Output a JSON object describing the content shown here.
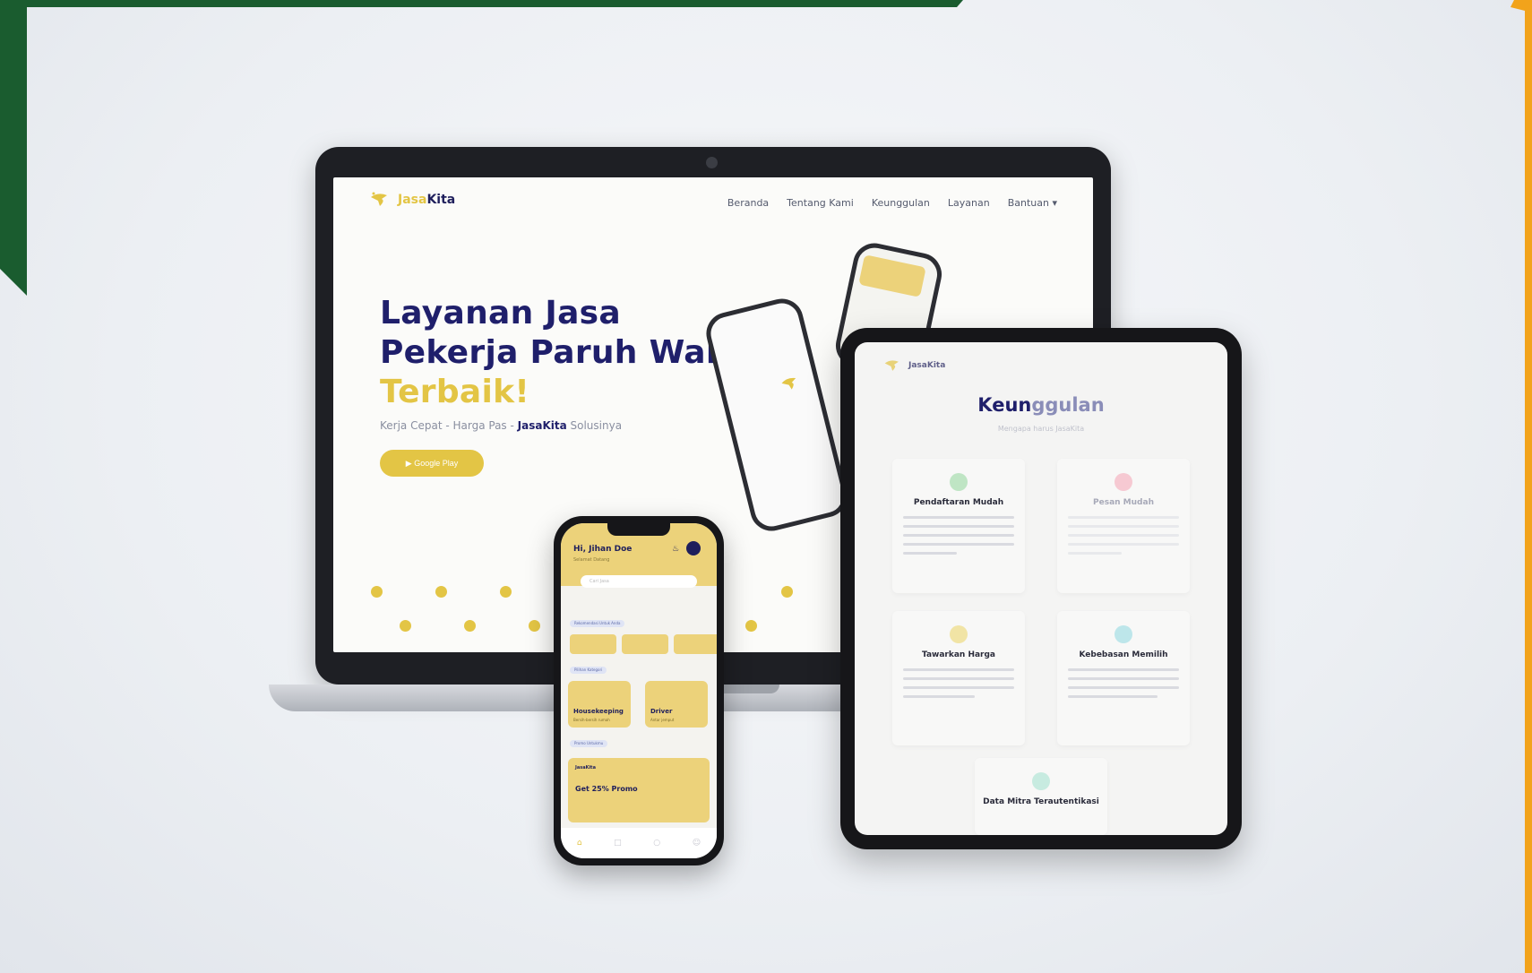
{
  "colors": {
    "navy": "#1f1f6b",
    "yellow": "#e3c545",
    "brand_green": "#1a5c2f",
    "orange": "#f2a31b"
  },
  "laptop": {
    "brand_name_part1": "Jasa",
    "brand_name_part2": "Kita",
    "nav": [
      "Beranda",
      "Tentang Kami",
      "Keunggulan",
      "Layanan",
      "Bantuan ▾"
    ],
    "hero_line1": "Layanan Jasa",
    "hero_line2": "Pekerja Paruh Waktu",
    "hero_line3": "Terbaik!",
    "tagline_prefix": "Kerja Cepat - Harga Pas - ",
    "tagline_brand": "JasaKita",
    "tagline_suffix": " Solusinya",
    "cta_label": "▶ Google Play"
  },
  "tablet": {
    "brand_name": "JasaKita",
    "title_part1": "Keun",
    "title_part2": "ggulan",
    "subtitle": "Mengapa harus JasaKita",
    "cards": [
      {
        "title": "Pendaftaran Mudah",
        "icon": "checklist-icon",
        "color": "#bfe5c4"
      },
      {
        "title": "Pesan Mudah",
        "icon": "cart-icon",
        "color": "#f6c9d2"
      },
      {
        "title": "Tawarkan Harga",
        "icon": "price-tag-icon",
        "color": "#f1e4a5"
      },
      {
        "title": "Kebebasan Memilih",
        "icon": "globe-icon",
        "color": "#bde6ea"
      },
      {
        "title": "Data Mitra Terautentikasi",
        "icon": "shield-icon",
        "color": "#c7ebe0"
      }
    ]
  },
  "phone": {
    "greeting": "Hi, Jihan Doe",
    "greeting_sub": "Selamat Datang",
    "search_placeholder": "Cari Jasa",
    "section1": "Rekomendasi Untuk Anda",
    "section2": "Pilihan Kategori",
    "tile1_title": "Housekeeping",
    "tile1_sub": "Bersih-bersih rumah",
    "tile2_title": "Driver",
    "tile2_sub": "Antar jemput",
    "section3": "Promo Untukmu",
    "promo_brand": "JasaKita",
    "promo_title": "Get 25% Promo"
  }
}
